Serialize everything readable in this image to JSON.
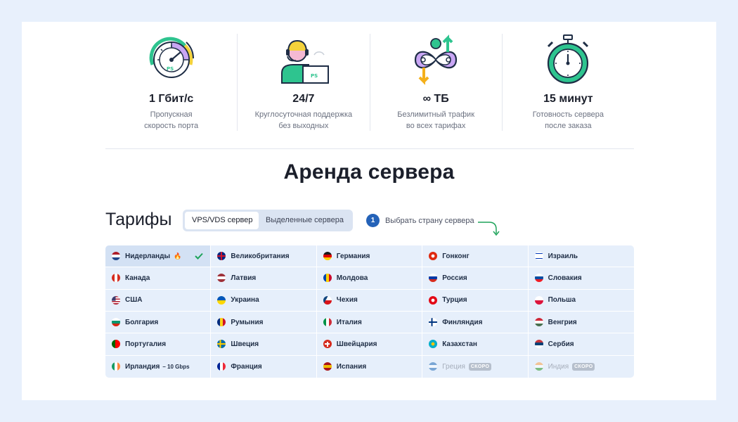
{
  "features": [
    {
      "icon": "speedometer-icon",
      "value": "1 Гбит/с",
      "desc1": "Пропускная",
      "desc2": "скорость порта"
    },
    {
      "icon": "support-operator-icon",
      "value": "24/7",
      "desc1": "Круглосуточная поддержка",
      "desc2": "без выходных"
    },
    {
      "icon": "infinity-traffic-icon",
      "value": "∞ ТБ",
      "desc1": "Безлимитный трафик",
      "desc2": "во всех тарифах"
    },
    {
      "icon": "stopwatch-icon",
      "value": "15 минут",
      "desc1": "Готовность сервера",
      "desc2": "после заказа"
    }
  ],
  "title": "Аренда сервера",
  "tariffs": {
    "title": "Тарифы",
    "tabs": {
      "vps": "VPS/VDS сервер",
      "dedicated": "Выделенные сервера"
    },
    "step": {
      "number": "1",
      "text": "Выбрать страну сервера"
    }
  },
  "countries": [
    {
      "name": "Нидерланды",
      "flag": "nl"
    },
    {
      "name": "Великобритания",
      "flag": "gb"
    },
    {
      "name": "Германия",
      "flag": "de"
    },
    {
      "name": "Гонконг",
      "flag": "hk"
    },
    {
      "name": "Израиль",
      "flag": "il"
    },
    {
      "name": "Канада",
      "flag": "ca"
    },
    {
      "name": "Латвия",
      "flag": "lv"
    },
    {
      "name": "Молдова",
      "flag": "md"
    },
    {
      "name": "Россия",
      "flag": "ru"
    },
    {
      "name": "Словакия",
      "flag": "sk"
    },
    {
      "name": "США",
      "flag": "us"
    },
    {
      "name": "Украина",
      "flag": "ua"
    },
    {
      "name": "Чехия",
      "flag": "cz"
    },
    {
      "name": "Турция",
      "flag": "tr"
    },
    {
      "name": "Польша",
      "flag": "pl"
    },
    {
      "name": "Болгария",
      "flag": "bg"
    },
    {
      "name": "Румыния",
      "flag": "ro"
    },
    {
      "name": "Италия",
      "flag": "it"
    },
    {
      "name": "Финляндия",
      "flag": "fi"
    },
    {
      "name": "Венгрия",
      "flag": "hu"
    },
    {
      "name": "Португалия",
      "flag": "pt"
    },
    {
      "name": "Швеция",
      "flag": "se"
    },
    {
      "name": "Швейцария",
      "flag": "ch"
    },
    {
      "name": "Казахстан",
      "flag": "kz"
    },
    {
      "name": "Сербия",
      "flag": "rs"
    },
    {
      "name": "Ирландия",
      "flag": "ie",
      "suffix": "– 10 Gbps"
    },
    {
      "name": "Франция",
      "flag": "fr"
    },
    {
      "name": "Испания",
      "flag": "es"
    },
    {
      "name": "Греция",
      "flag": "gr",
      "badge": "СКОРО"
    },
    {
      "name": "Индия",
      "flag": "in",
      "badge": "СКОРО"
    }
  ],
  "selected_country": "Нидерланды",
  "colors": {
    "accent": "#2462b8",
    "check": "#1ea35a",
    "grid_bg": "#e6effb",
    "page_bg": "#e8f0fc"
  }
}
